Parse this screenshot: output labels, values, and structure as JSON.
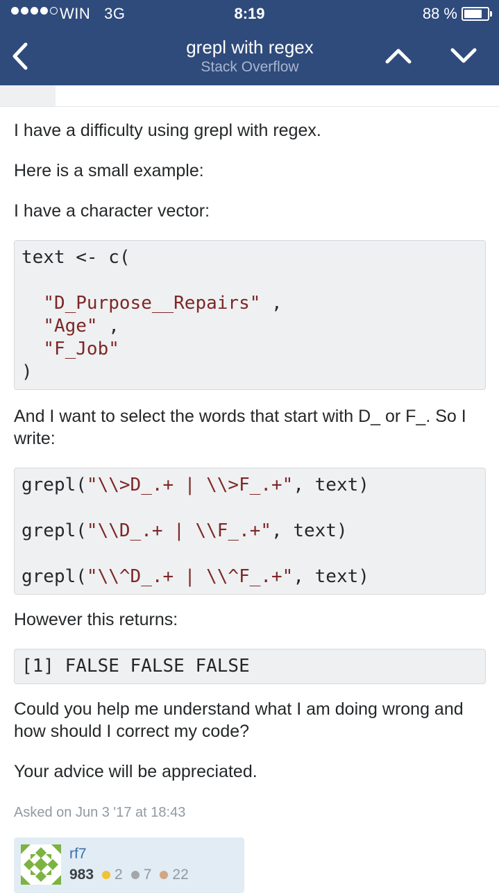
{
  "status_bar": {
    "carrier": "WIN",
    "network": "3G",
    "time": "8:19",
    "battery": "88 %",
    "battery_level": 0.88
  },
  "nav": {
    "title": "grepl with regex",
    "subtitle": "Stack Overflow",
    "icons": {
      "back": "chevron-left-icon",
      "prev": "chevron-up-icon",
      "next": "chevron-down-icon"
    }
  },
  "question": {
    "p1": "I have a difficulty using grepl with regex.",
    "p2": "Here is a small example:",
    "p3": "I have a character vector:",
    "code1": {
      "line1": "text <- c(",
      "line2_str": "\"D_Purpose__Repairs\"",
      "line2_rest": " ,",
      "line3_str": "\"Age\"",
      "line3_rest": " ,",
      "line4_str": "\"F_Job\"",
      "line5": ")"
    },
    "p4": "And I want to select the words that start with D_ or F_. So I write:",
    "code2": {
      "a_fn": "grepl(",
      "a_str": "\"\\\\>D_.+ | \\\\>F_.+\"",
      "a_rest": ", text)",
      "b_fn": "grepl(",
      "b_str": "\"\\\\D_.+ | \\\\F_.+\"",
      "b_rest": ", text)",
      "c_fn": "grepl(",
      "c_str": "\"\\\\^D_.+ | \\\\^F_.+\"",
      "c_rest": ", text)"
    },
    "p5": "However this returns:",
    "code3": "[1] FALSE FALSE FALSE",
    "p6": "Could you help me understand what I am doing wrong and how should I correct my code?",
    "p7": "Your advice will be appreciated.",
    "asked": "Asked on Jun 3 '17 at 18:43"
  },
  "user": {
    "name": "rf7",
    "reputation": "983",
    "gold": "2",
    "silver": "7",
    "bronze": "22"
  },
  "colors": {
    "header": "#2f4b7c",
    "code_bg": "#eff0f1",
    "string": "#7d2727",
    "gold": "#f1c232",
    "silver": "#a3a7ab",
    "bronze": "#d1a684"
  }
}
